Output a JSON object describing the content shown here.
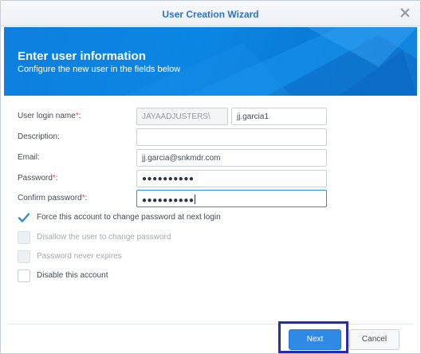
{
  "window": {
    "title": "User Creation Wizard"
  },
  "banner": {
    "heading": "Enter user information",
    "subheading": "Configure the new user in the fields below"
  },
  "form": {
    "login": {
      "label": "User login name",
      "required": "*",
      "colon": ":",
      "domain": "JAYAADJUSTERS\\",
      "value": "jj.garcia1"
    },
    "description": {
      "label": "Description:",
      "value": ""
    },
    "email": {
      "label": "Email:",
      "value": "jj.garcia@snkmdr.com"
    },
    "password": {
      "label": "Password",
      "required": "*",
      "colon": ":",
      "masked": "●●●●●●●●●●"
    },
    "confirm_password": {
      "label": "Confirm password",
      "required": "*",
      "colon": ":",
      "masked": "●●●●●●●●●●"
    }
  },
  "options": {
    "force_change": {
      "label": "Force this account to change password at next login",
      "checked": true,
      "enabled": true
    },
    "disallow_change": {
      "label": "Disallow the user to change password",
      "checked": false,
      "enabled": false
    },
    "never_expires": {
      "label": "Password never expires",
      "checked": false,
      "enabled": false
    },
    "disable_account": {
      "label": "Disable this account",
      "checked": false,
      "enabled": true
    }
  },
  "buttons": {
    "next": "Next",
    "cancel": "Cancel"
  },
  "colors": {
    "accent": "#2f8ae6",
    "title": "#2d74bd",
    "required": "#e84a4a",
    "highlight": "#2b2ba6"
  },
  "icons": {
    "close": "close-icon",
    "check": "checkmark-icon"
  }
}
